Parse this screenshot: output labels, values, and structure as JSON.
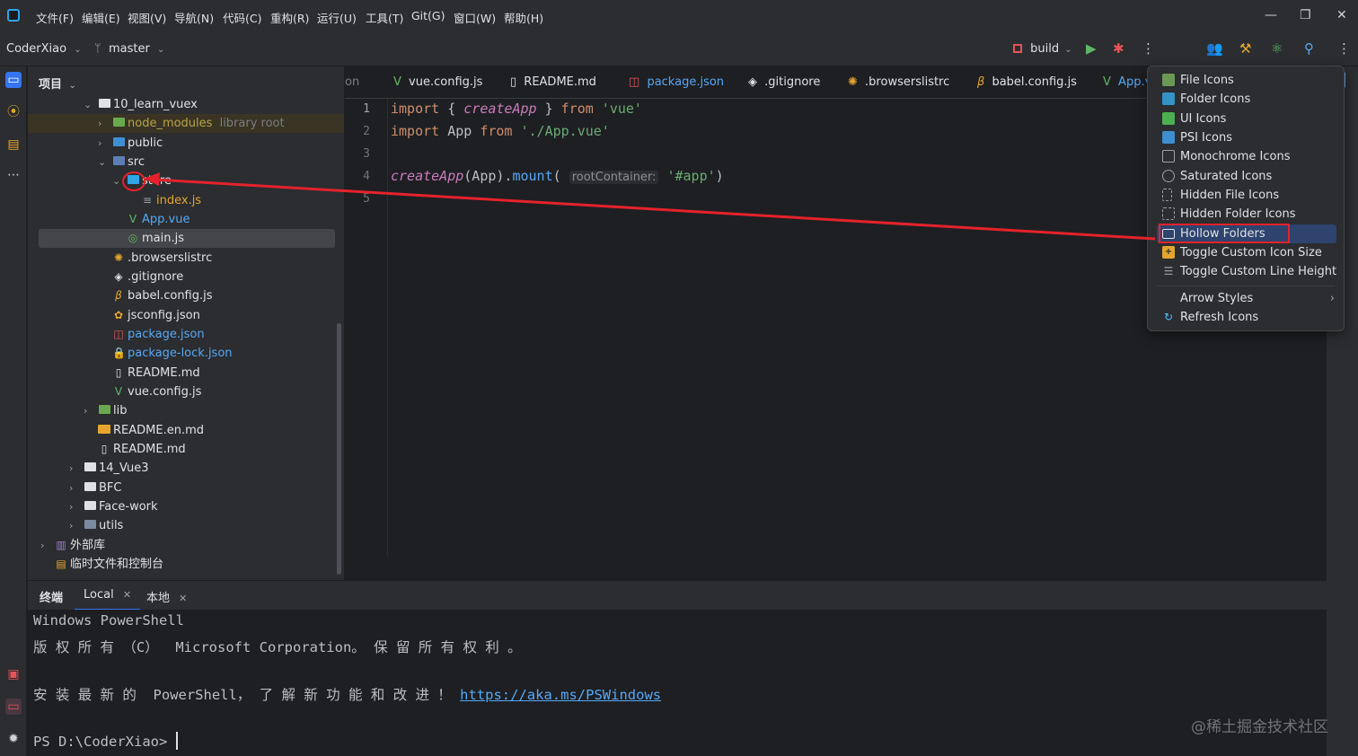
{
  "menu": {
    "items": [
      "文件(F)",
      "编辑(E)",
      "视图(V)",
      "导航(N)",
      "代码(C)",
      "重构(R)",
      "运行(U)",
      "工具(T)",
      "Git(G)",
      "窗口(W)",
      "帮助(H)"
    ],
    "window_controls": [
      "—",
      "❐",
      "✕"
    ]
  },
  "toolbar": {
    "project_name": "CoderXiao",
    "branch": "master",
    "run_config": "build"
  },
  "project_panel": {
    "title": "项目",
    "tree": [
      {
        "label": "10_learn_vuex",
        "type": "folder"
      },
      {
        "label": "node_modules",
        "suffix": "library root",
        "type": "folder"
      },
      {
        "label": "public",
        "type": "folder"
      },
      {
        "label": "src",
        "type": "folder"
      },
      {
        "label": "store",
        "type": "folder"
      },
      {
        "label": "index.js",
        "type": "file"
      },
      {
        "label": "App.vue",
        "type": "file"
      },
      {
        "label": "main.js",
        "type": "file"
      },
      {
        "label": ".browserslistrc",
        "type": "file"
      },
      {
        "label": ".gitignore",
        "type": "file"
      },
      {
        "label": "babel.config.js",
        "type": "file"
      },
      {
        "label": "jsconfig.json",
        "type": "file"
      },
      {
        "label": "package.json",
        "type": "file"
      },
      {
        "label": "package-lock.json",
        "type": "file"
      },
      {
        "label": "README.md",
        "type": "file"
      },
      {
        "label": "vue.config.js",
        "type": "file"
      },
      {
        "label": "lib",
        "type": "folder"
      },
      {
        "label": "README.en.md",
        "type": "file"
      },
      {
        "label": "README.md",
        "type": "file"
      },
      {
        "label": "14_Vue3",
        "type": "folder"
      },
      {
        "label": "BFC",
        "type": "folder"
      },
      {
        "label": "Face-work",
        "type": "folder"
      },
      {
        "label": "utils",
        "type": "folder"
      },
      {
        "label": "外部库",
        "type": "folder"
      },
      {
        "label": "临时文件和控制台",
        "type": "folder"
      }
    ]
  },
  "editor": {
    "tabs": [
      "on",
      "vue.config.js",
      "README.md",
      "package.json",
      ".gitignore",
      ".browserslistrc",
      "babel.config.js",
      "App.v"
    ],
    "line_numbers": [
      "1",
      "2",
      "3",
      "4",
      "5"
    ],
    "code": {
      "l1_kw": "import",
      "l1_brace_open": " { ",
      "l1_name": "createApp",
      "l1_brace_close": " } ",
      "l1_from": "from",
      "l1_str": " 'vue'",
      "l2_kw": "import",
      "l2_name": " App ",
      "l2_from": "from",
      "l2_str": " './App.vue'",
      "l4_fn": "createApp",
      "l4_p1": "(App).",
      "l4_mount": "mount",
      "l4_p2": "( ",
      "l4_hint": "rootContainer:",
      "l4_str": " '#app'",
      "l4_p3": ")"
    }
  },
  "terminal": {
    "title": "终端",
    "tabs": [
      "Local",
      "本地"
    ],
    "lines": {
      "l1": "Windows PowerShell",
      "l2": "版 权 所 有 （C）  Microsoft Corporation。 保 留 所 有 权 利 。",
      "l3_prefix": "安 装 最 新 的  PowerShell， 了 解 新 功 能 和 改 进 ！ ",
      "l3_link": "https://aka.ms/PSWindows",
      "l4": "PS D:\\CoderXiao> "
    }
  },
  "popup_menu": {
    "items": [
      {
        "label": "File Icons",
        "icon_color": "#6a9955"
      },
      {
        "label": "Folder Icons",
        "icon_color": "#3592c4"
      },
      {
        "label": "UI Icons",
        "icon_color": "#4caf50"
      },
      {
        "label": "PSI Icons",
        "icon_color": "#3d8fd1"
      },
      {
        "label": "Monochrome Icons",
        "icon_color": "#9da0a8"
      },
      {
        "label": "Saturated Icons",
        "icon_color": "#9da0a8"
      },
      {
        "label": "Hidden File Icons",
        "icon_color": "#9da0a8"
      },
      {
        "label": "Hidden Folder Icons",
        "icon_color": "#9da0a8"
      },
      {
        "label": "Hollow Folders",
        "icon_color": "#dfe1e5",
        "selected": true
      },
      {
        "label": "Toggle Custom Icon Size",
        "icon_color": "#e5a52d"
      },
      {
        "label": "Toggle Custom Line Height",
        "icon_color": "#9da0a8"
      },
      {
        "label": "Arrow Styles",
        "has_submenu": true
      },
      {
        "label": "Refresh Icons",
        "icon_color": "#4fc1ff"
      }
    ],
    "submenu_arrow": "›"
  },
  "colors": {
    "accent": "#3574f0",
    "annotation_red": "#e5222b",
    "selection": "#2e436e"
  },
  "watermark": "@稀土掘金技术社区"
}
